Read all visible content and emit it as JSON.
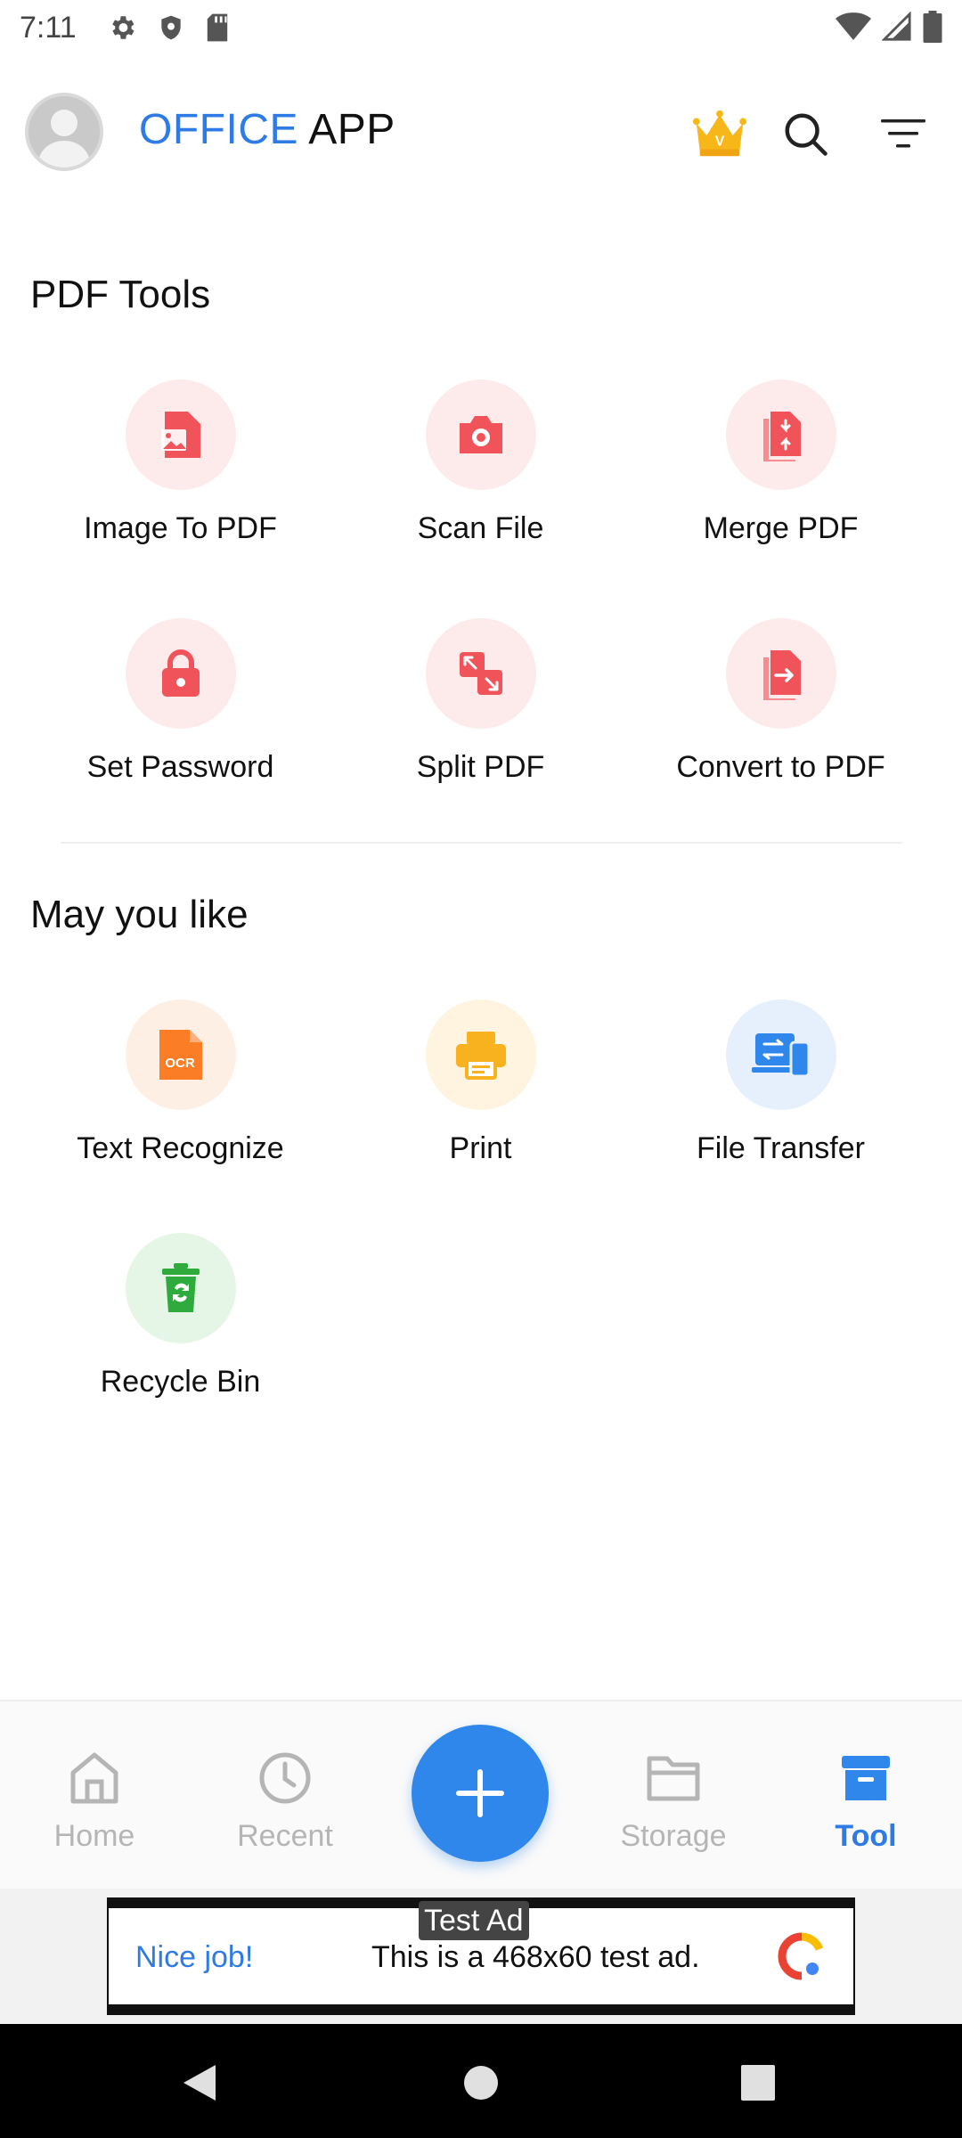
{
  "status_bar": {
    "time": "7:11"
  },
  "app_bar": {
    "title_part1": "OFFICE",
    "title_part2": "APP",
    "crown_badge": "V"
  },
  "pdf_tools": {
    "title": "PDF Tools",
    "items": [
      {
        "label": "Image To PDF",
        "icon": "image-to-pdf-icon"
      },
      {
        "label": "Scan File",
        "icon": "camera-icon"
      },
      {
        "label": "Merge PDF",
        "icon": "merge-pdf-icon"
      },
      {
        "label": "Set Password",
        "icon": "lock-icon"
      },
      {
        "label": "Split PDF",
        "icon": "split-pdf-icon"
      },
      {
        "label": "Convert to PDF",
        "icon": "convert-to-pdf-icon"
      }
    ]
  },
  "may_you_like": {
    "title": "May you like",
    "items": [
      {
        "label": "Text Recognize",
        "icon": "ocr-icon",
        "icon_text": "OCR"
      },
      {
        "label": "Print",
        "icon": "printer-icon"
      },
      {
        "label": "File Transfer",
        "icon": "file-transfer-icon"
      },
      {
        "label": "Recycle Bin",
        "icon": "recycle-bin-icon"
      }
    ]
  },
  "bottom_nav": {
    "items": [
      {
        "label": "Home",
        "icon": "home-icon"
      },
      {
        "label": "Recent",
        "icon": "clock-icon"
      },
      {
        "label": "Storage",
        "icon": "folder-icon"
      },
      {
        "label": "Tool",
        "icon": "toolbox-icon",
        "active": true
      }
    ],
    "fab_icon": "plus-icon"
  },
  "ad": {
    "tag": "Test Ad",
    "headline": "Nice job!",
    "text": "This is a 468x60 test ad."
  },
  "colors": {
    "accent": "#2f7be6",
    "pdf_red": "#f0545a",
    "pdf_circle": "#fdeaea",
    "ocr_orange": "#fb7d26",
    "print_yellow": "#f8b21f",
    "transfer_blue": "#2f86eb",
    "recycle_green": "#2faa3c"
  }
}
